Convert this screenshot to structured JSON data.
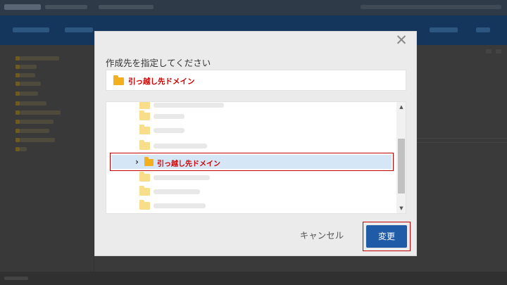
{
  "dialog": {
    "close_glyph": "✕",
    "title": "作成先を指定してください",
    "selected_destination": "引っ越し先ドメイン",
    "tree": {
      "highlighted_item": {
        "expand_glyph": "›",
        "label": "引っ越し先ドメイン"
      }
    },
    "scroll_up_glyph": "▲",
    "scroll_down_glyph": "▼",
    "cancel_label": "キャンセル",
    "confirm_label": "変更"
  },
  "colors": {
    "primary_button": "#1f5ba6",
    "annotation_red": "#c00000",
    "folder": "#f2b01e",
    "selected_row": "#d5e6f7"
  },
  "icons": {
    "folder": "folder-icon",
    "close": "close-icon",
    "expand": "chevron-right-icon"
  }
}
